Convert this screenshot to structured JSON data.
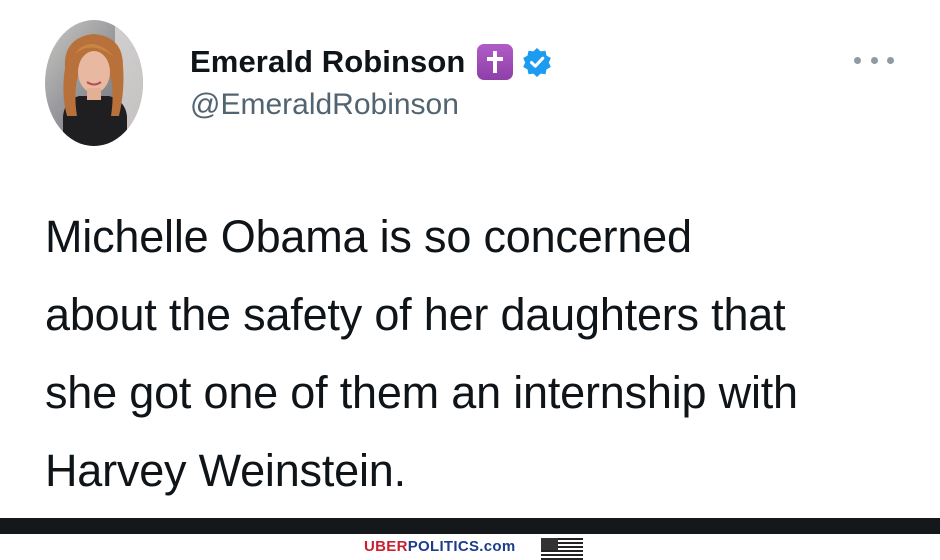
{
  "author": {
    "display_name": "Emerald Robinson",
    "handle": "@EmeraldRobinson",
    "emoji_icon": "latin-cross-emoji",
    "verified_icon": "verified-badge-icon"
  },
  "tweet": {
    "lines": [
      "Michelle Obama is so concerned",
      "about the safety of her daughters that",
      "she got one of them an internship with",
      "Harvey Weinstein."
    ]
  },
  "footer": {
    "brand_part1": "UBER",
    "brand_part2": "POLITICS.com"
  },
  "colors": {
    "text": "#0f1419",
    "handle": "#536471",
    "verified": "#1d9bf0",
    "emoji_bg": "#9b4cb8",
    "brand_red": "#cc1e2e",
    "brand_blue": "#1c3c8c"
  }
}
